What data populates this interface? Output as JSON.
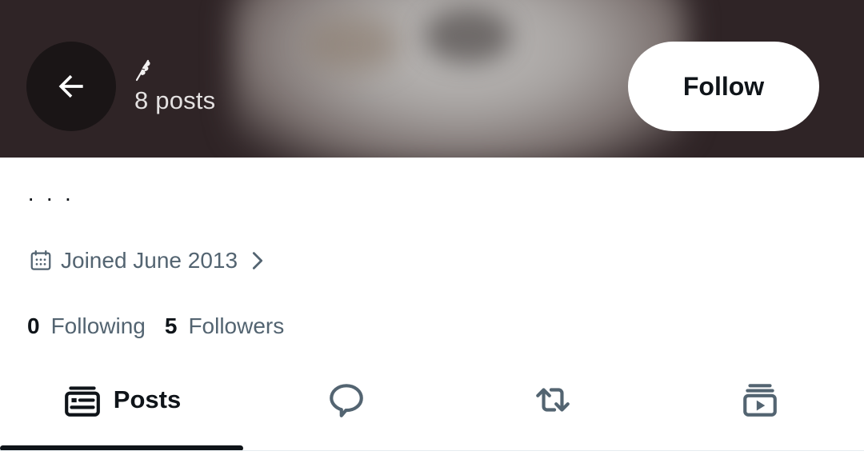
{
  "header": {
    "back_icon": "arrow-left-icon",
    "badge_icon": "leaf-icon",
    "posts_count": "8 posts",
    "follow_label": "Follow",
    "banner_color": "#2f2426"
  },
  "profile": {
    "bio": "· · ·",
    "joined_icon": "calendar-icon",
    "joined": "Joined June 2013",
    "joined_chevron_icon": "chevron-right-icon",
    "following_count": "0",
    "following_label": "Following",
    "followers_count": "5",
    "followers_label": "Followers"
  },
  "tabs": [
    {
      "icon": "posts-icon",
      "label": "Posts",
      "active": true
    },
    {
      "icon": "reply-bubble-icon",
      "active": false
    },
    {
      "icon": "repost-icon",
      "active": false
    },
    {
      "icon": "media-icon",
      "active": false
    }
  ],
  "colors": {
    "text_primary": "#0f1419",
    "text_secondary": "#536471",
    "accent": "#0f1419"
  }
}
